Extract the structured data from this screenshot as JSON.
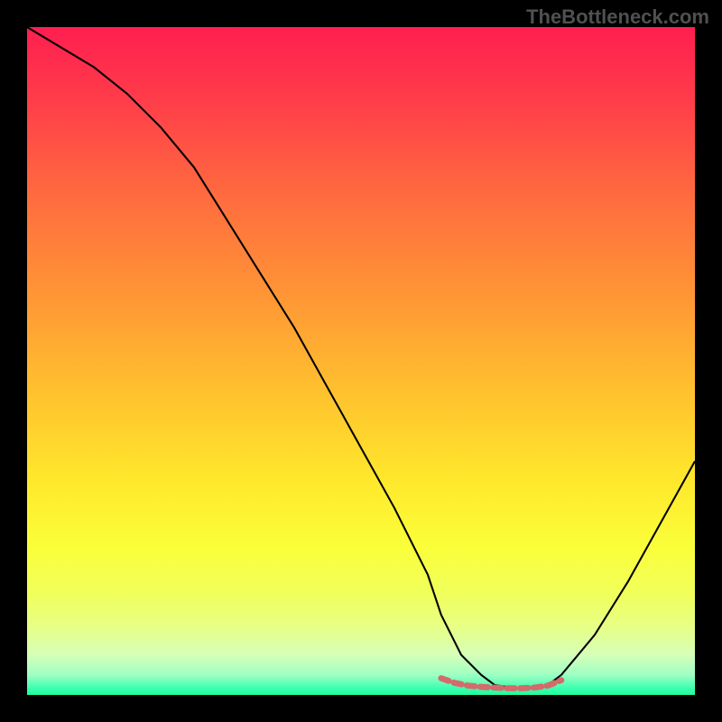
{
  "watermark": "TheBottleneck.com",
  "chart_data": {
    "type": "line",
    "title": "",
    "xlabel": "",
    "ylabel": "",
    "xlim": [
      0,
      100
    ],
    "ylim": [
      0,
      100
    ],
    "series": [
      {
        "name": "bottleneck-curve",
        "color": "#000000",
        "x": [
          0,
          5,
          10,
          15,
          20,
          25,
          30,
          35,
          40,
          45,
          50,
          55,
          60,
          62,
          65,
          68,
          70,
          73,
          76,
          78,
          80,
          85,
          90,
          95,
          100
        ],
        "values": [
          100,
          97,
          94,
          90,
          85,
          79,
          71,
          63,
          55,
          46,
          37,
          28,
          18,
          12,
          6,
          3,
          1.5,
          1,
          1,
          1.5,
          3,
          9,
          17,
          26,
          35
        ]
      },
      {
        "name": "optimal-band-markers",
        "color": "#d46a6a",
        "x": [
          62,
          64,
          66,
          68,
          70,
          72,
          74,
          76,
          78,
          80
        ],
        "values": [
          2.5,
          1.8,
          1.4,
          1.2,
          1.1,
          1.0,
          1.0,
          1.1,
          1.4,
          2.2
        ]
      }
    ],
    "background_gradient": {
      "top": "#ff1e50",
      "mid": "#ffe82c",
      "bottom": "#1eff9a"
    }
  }
}
